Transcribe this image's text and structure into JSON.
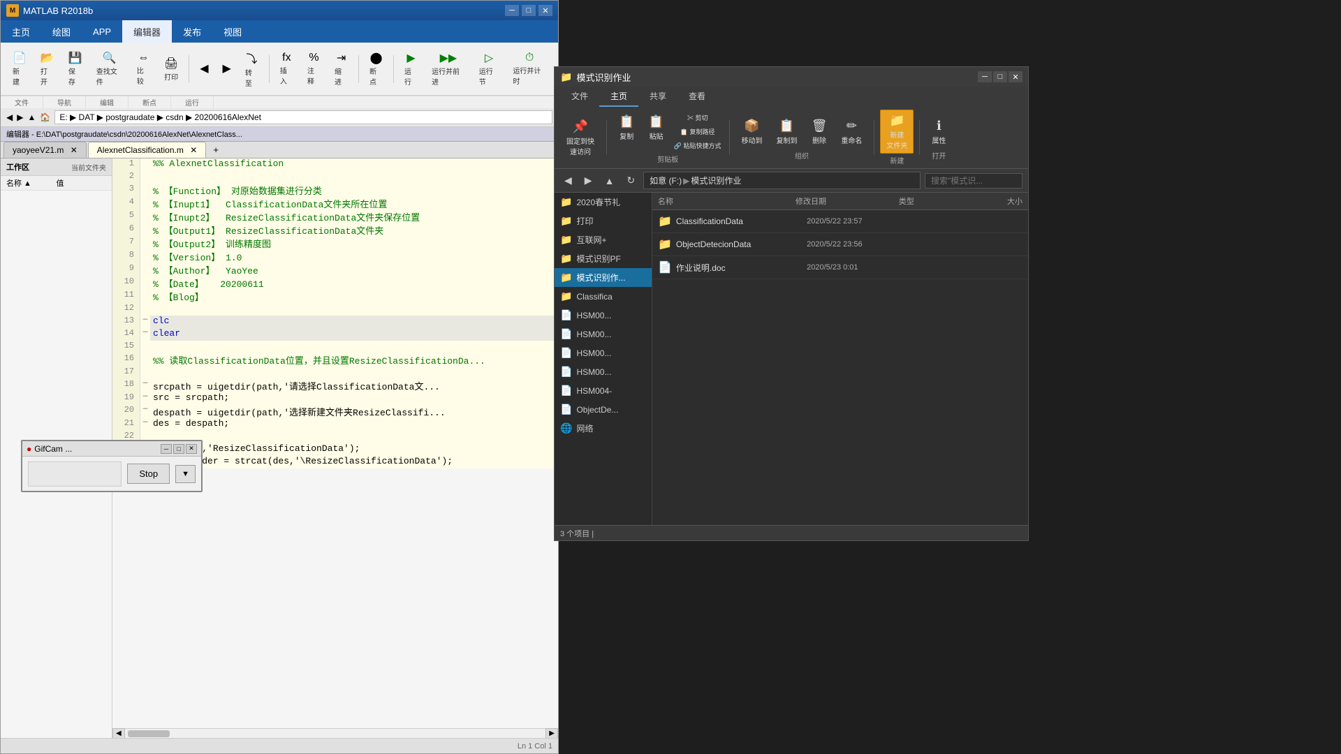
{
  "matlab": {
    "title": "MATLAB R2018b",
    "icon": "M",
    "menus": [
      "主页",
      "绘图",
      "APP",
      "编辑器",
      "发布",
      "视图"
    ],
    "active_menu": "编辑器",
    "address": "E: ▶ DAT ▶ postgraudate ▶ csdn ▶ 20200616AlexNet",
    "breadcrumb": "E: > DAT > postgraudate > csdn > 20200616AlexNet",
    "editor_header": "编辑器 - E:\\DAT\\postgraudate\\csdn\\20200616AlexNet\\AlexnetClass...",
    "tabs": [
      {
        "label": "yaoyeeV21.m",
        "active": false
      },
      {
        "label": "AlexnetClassification.m",
        "active": true
      }
    ],
    "sidebar_title": "工作区",
    "sidebar_subtitle": "当前文件夹",
    "sidebar_col1": "名称 ▲",
    "sidebar_col2": "值",
    "code_lines": [
      {
        "num": 1,
        "marker": "",
        "content": "%% AlexnetClassification",
        "class": "c-green"
      },
      {
        "num": 2,
        "marker": "",
        "content": "",
        "class": ""
      },
      {
        "num": 3,
        "marker": "",
        "content": "% 【Function】 对原始数据集进行分类",
        "class": "c-green"
      },
      {
        "num": 4,
        "marker": "",
        "content": "% 【Inupt1】  ClassificationData文件夹所在位置",
        "class": "c-green"
      },
      {
        "num": 5,
        "marker": "",
        "content": "% 【Inupt2】  ResizeClassificationData文件夹保存位置",
        "class": "c-green"
      },
      {
        "num": 6,
        "marker": "",
        "content": "% 【Output1】 ResizeClassificationData文件夹",
        "class": "c-green"
      },
      {
        "num": 7,
        "marker": "",
        "content": "% 【Output2】 训练精度图",
        "class": "c-green"
      },
      {
        "num": 8,
        "marker": "",
        "content": "% 【Version】 1.0",
        "class": "c-green"
      },
      {
        "num": 9,
        "marker": "",
        "content": "% 【Author】  YaoYee",
        "class": "c-green"
      },
      {
        "num": 10,
        "marker": "",
        "content": "% 【Date】   20200611",
        "class": "c-green"
      },
      {
        "num": 11,
        "marker": "",
        "content": "% 【Blog】",
        "class": "c-green"
      },
      {
        "num": 12,
        "marker": "",
        "content": "",
        "class": ""
      },
      {
        "num": 13,
        "marker": "—",
        "content": "clc",
        "class": "c-blue c-highlight"
      },
      {
        "num": 14,
        "marker": "—",
        "content": "clear",
        "class": "c-blue c-highlight"
      },
      {
        "num": 15,
        "marker": "",
        "content": "",
        "class": ""
      },
      {
        "num": 16,
        "marker": "",
        "content": "%% 读取ClassificationData位置，并且设置ResizeClassificationDa...",
        "class": "c-green"
      },
      {
        "num": 17,
        "marker": "",
        "content": "",
        "class": ""
      },
      {
        "num": 18,
        "marker": "—",
        "content": "srcpath = uigetdir(path,'请选择ClassificationData文...",
        "class": ""
      },
      {
        "num": 19,
        "marker": "—",
        "content": "src = srcpath;",
        "class": ""
      },
      {
        "num": 20,
        "marker": "—",
        "content": "despath = uigetdir(path,'选择新建文件夹ResizeClassifi...",
        "class": ""
      },
      {
        "num": 21,
        "marker": "—",
        "content": "des = despath;",
        "class": ""
      },
      {
        "num": 22,
        "marker": "",
        "content": "",
        "class": ""
      },
      {
        "num": 23,
        "marker": "—",
        "content": "mkdir(des,'ResizeClassificationData');",
        "class": ""
      },
      {
        "num": 24,
        "marker": "—",
        "content": "ResizeFolder = strcat(des,'\\ResizeClassificationData');",
        "class": ""
      }
    ],
    "status": ""
  },
  "file_explorer": {
    "title": "模式识别作业",
    "ribbon_tabs": [
      "文件",
      "主页",
      "共享",
      "查看"
    ],
    "active_ribbon_tab": "主页",
    "path_parts": [
      "如意 (F:)",
      "模式识别作业"
    ],
    "search_placeholder": "搜索\"模式识...",
    "sidebar_items": [
      {
        "label": "2020春节礼",
        "icon": "📁",
        "selected": false
      },
      {
        "label": "打印",
        "icon": "📁",
        "selected": false
      },
      {
        "label": "互联网+",
        "icon": "📁",
        "selected": false
      },
      {
        "label": "模式识别PF",
        "icon": "📁",
        "selected": false
      },
      {
        "label": "模式识别作...",
        "icon": "📁",
        "selected": true
      },
      {
        "label": "Classifica",
        "icon": "📁",
        "selected": false
      },
      {
        "label": "HSM00...",
        "icon": "📄",
        "selected": false
      },
      {
        "label": "HSM00...",
        "icon": "📄",
        "selected": false
      },
      {
        "label": "HSM00...",
        "icon": "📄",
        "selected": false
      },
      {
        "label": "HSM00...",
        "icon": "📄",
        "selected": false
      },
      {
        "label": "HSM004-",
        "icon": "📄",
        "selected": false
      },
      {
        "label": "ObjectDe...",
        "icon": "📄",
        "selected": false
      },
      {
        "label": "网络",
        "icon": "🌐",
        "selected": false
      }
    ],
    "col_headers": [
      "名称",
      "修改日期",
      "类型",
      "大小"
    ],
    "files": [
      {
        "name": "ClassificationData",
        "date": "2020/5/22 23:57",
        "type": "",
        "size": "",
        "icon": "📁"
      },
      {
        "name": "ObjectDetecionData",
        "date": "2020/5/22 23:56",
        "type": "",
        "size": "",
        "icon": "📁"
      },
      {
        "name": "作业说明.doc",
        "date": "2020/5/23 0:01",
        "type": "",
        "size": "",
        "icon": "📄"
      }
    ],
    "status_count": "3 个项目 |"
  },
  "gifcam": {
    "title": "GifCam ...",
    "icon": "●",
    "stop_label": "Stop",
    "arrow_label": "▼"
  },
  "toolbar": {
    "new_label": "新建",
    "open_label": "打开",
    "save_label": "保存",
    "print_label": "打印",
    "find_files_label": "查找文件",
    "compare_label": "比较",
    "navigate_label": "转至",
    "insert_label": "插入",
    "comment_label": "注释",
    "indent_label": "缩进",
    "breakpoint_label": "断点",
    "run_label": "运行",
    "run_and_advance_label": "运行并前进",
    "run_section_label": "运行节",
    "run_timed_label": "运行并计时",
    "sections": [
      "文件",
      "导航",
      "编辑",
      "断点",
      "运行"
    ]
  }
}
